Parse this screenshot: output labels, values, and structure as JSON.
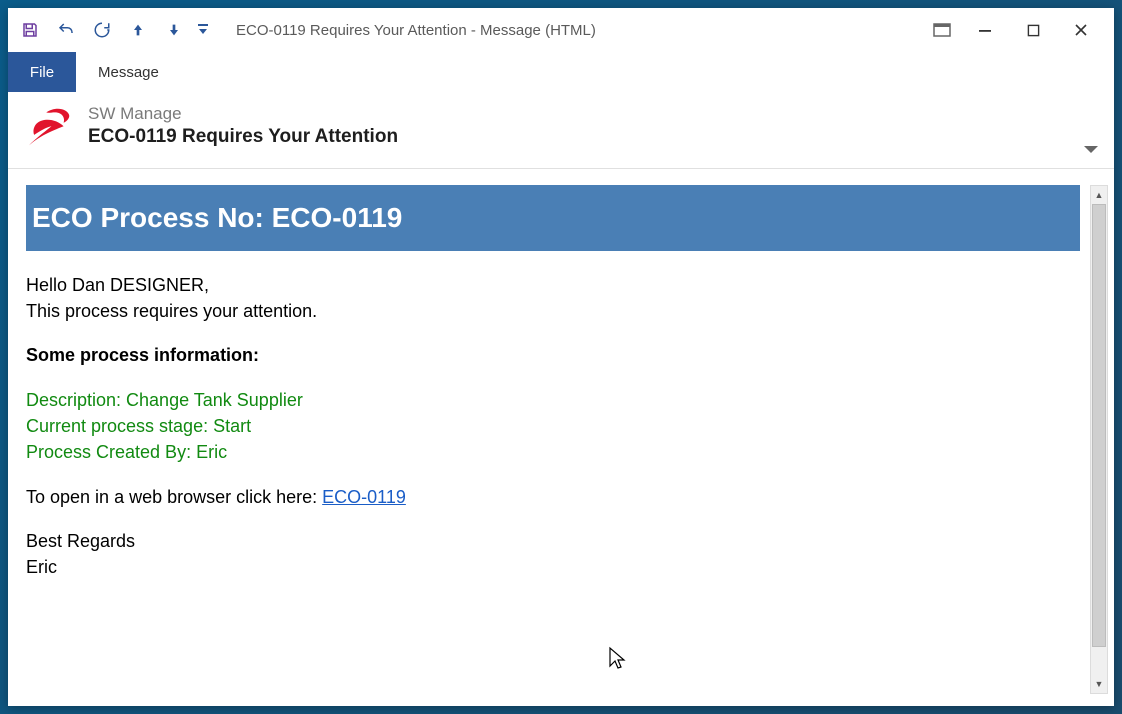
{
  "titlebar": {
    "title": "ECO-0119 Requires Your Attention - Message (HTML)"
  },
  "ribbon": {
    "file": "File",
    "message": "Message"
  },
  "header": {
    "sender": "SW Manage",
    "subject": "ECO-0119 Requires Your Attention"
  },
  "body": {
    "banner": "ECO Process No: ECO-0119",
    "greeting": "Hello Dan DESIGNER,",
    "attention": "This process requires your attention.",
    "section_head": "Some process information:",
    "desc": "Description: Change Tank Supplier",
    "stage": "Current process stage: Start",
    "created_by": "Process Created By: Eric",
    "open_prefix": "To open in a web browser click here: ",
    "open_link": "ECO-0119",
    "regards": "Best Regards",
    "signer": "Eric"
  }
}
